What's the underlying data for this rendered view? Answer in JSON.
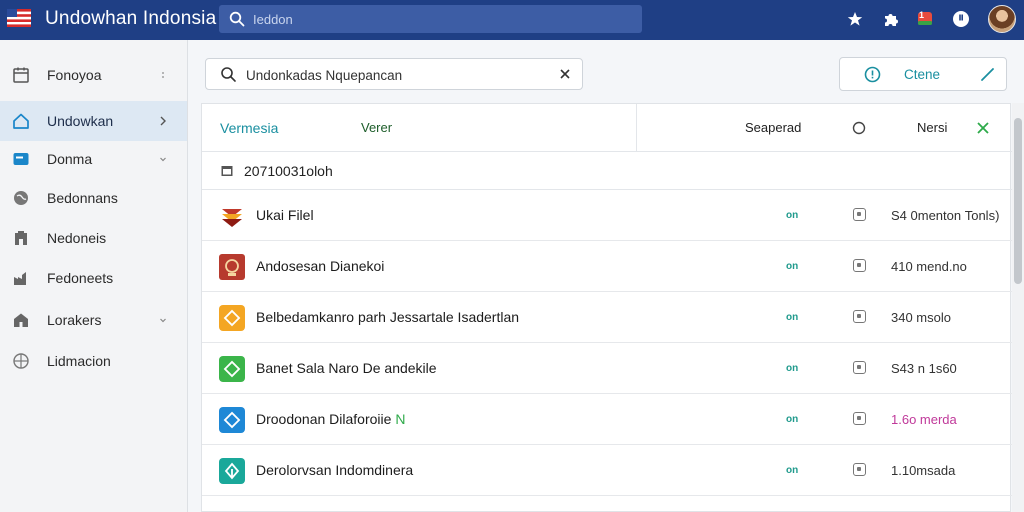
{
  "app": {
    "title": "Undowhan Indonsia",
    "search_placeholder": "Ieddon"
  },
  "topbar_icons": [
    "star-icon",
    "puzzle-icon",
    "notification-icon",
    "help-icon",
    "avatar"
  ],
  "notification_badge": "1",
  "sidebar": {
    "items": [
      {
        "label": "Fonoyoa",
        "icon": "calendar-icon"
      },
      {
        "label": "Undowkan",
        "icon": "home-icon",
        "active": true
      },
      {
        "label": "Donma",
        "icon": "card-icon"
      },
      {
        "label": "Bedonnans",
        "icon": "globe-icon"
      },
      {
        "label": "Nedoneis",
        "icon": "building-icon"
      },
      {
        "label": "Fedoneets",
        "icon": "factory-icon"
      },
      {
        "label": "Lorakers",
        "icon": "house-icon"
      },
      {
        "label": "Lidmacion",
        "icon": "network-icon"
      }
    ]
  },
  "search": {
    "value": "Undonkadas Nquepancan"
  },
  "action": {
    "label": "Ctene"
  },
  "table": {
    "header": {
      "col1": "Vermesia",
      "col2": "Verer",
      "col3": "Seaperad",
      "col4": "Nersi"
    },
    "subheader": "20710031oloh",
    "rows": [
      {
        "name": "Ukai Filel",
        "status": "on",
        "size": "S4 0menton Tonls)",
        "color": "#c0392b",
        "size_color": "#333333"
      },
      {
        "name": "Andosesan Dianekoi",
        "status": "on",
        "size": "410 mend.no",
        "color": "#b73a2e",
        "size_color": "#333333"
      },
      {
        "name": "Belbedamkanro parh Jessartale Isadertlan",
        "status": "on",
        "size": "340 msolo",
        "color": "#f4a623",
        "size_color": "#333333"
      },
      {
        "name": "Banet Sala Naro De andekile",
        "status": "on",
        "size": "S43 n 1s60",
        "color": "#3bb54a",
        "size_color": "#333333"
      },
      {
        "name": "Droodonan Dilaforoiie",
        "name_suffix": "N",
        "status": "on",
        "size": "1.6o merda",
        "color": "#1e88d6",
        "size_color": "#c0399a"
      },
      {
        "name": "Derolorvsan Indomdinera",
        "status": "on",
        "size": "1.10msada",
        "color": "#1aa89a",
        "size_color": "#333333"
      }
    ]
  },
  "colors": {
    "topbar": "#1f3f85",
    "accent": "#1a8fa0",
    "status_on": "#1f9a8c",
    "active_sidebar": "#dde8f3"
  }
}
